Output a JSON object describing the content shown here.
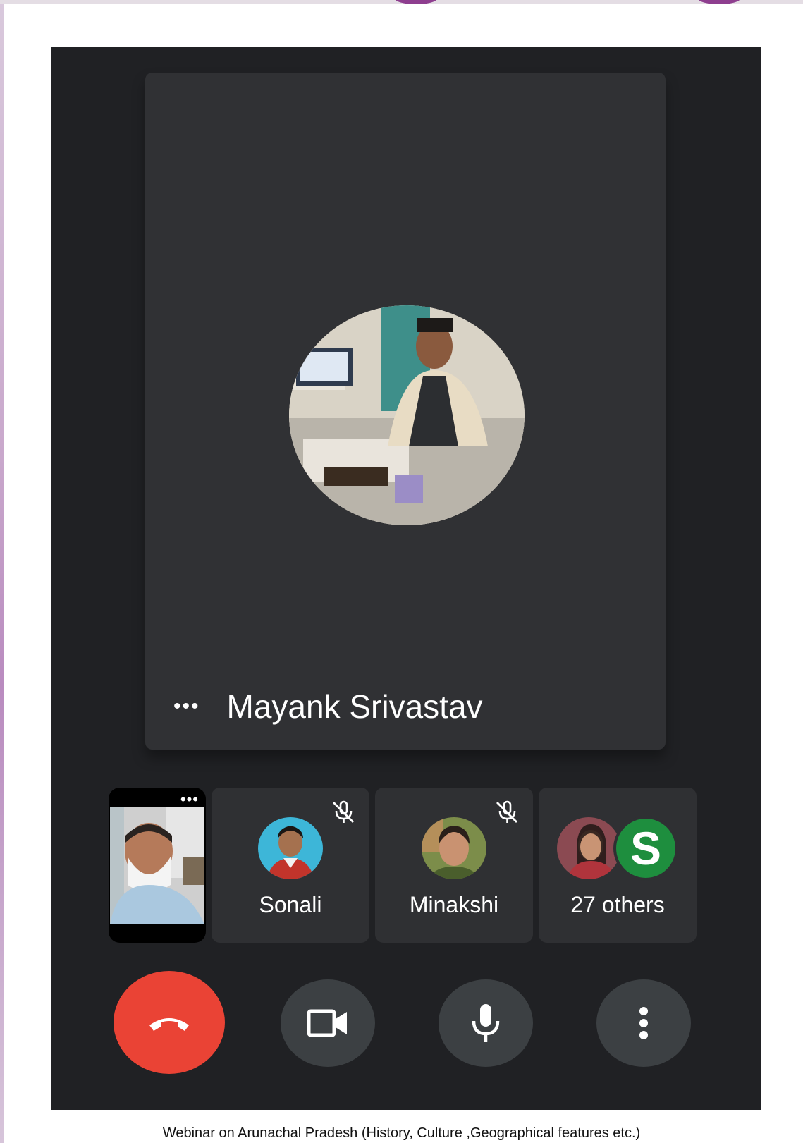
{
  "main": {
    "speaker_name": "Mayank Srivastav",
    "more_options_glyph": "•••"
  },
  "self_view": {
    "more_options_glyph": "•••"
  },
  "participants": [
    {
      "name": "Sonali",
      "muted": true
    },
    {
      "name": "Minakshi",
      "muted": true
    }
  ],
  "others": {
    "label": "27 others",
    "avatar_letter": "S",
    "avatar_color": "#1e8e3e"
  },
  "controls": {
    "end_call_icon": "phone-hangup-icon",
    "camera_icon": "video-camera-icon",
    "mic_icon": "microphone-icon",
    "more_icon": "more-vert-icon",
    "end_call_color": "#ea4335"
  },
  "colors": {
    "background": "#202124",
    "tile": "#303134",
    "control": "#3c4043"
  },
  "caption": "Webinar on Arunachal Pradesh (History, Culture ,Geographical features etc.)"
}
